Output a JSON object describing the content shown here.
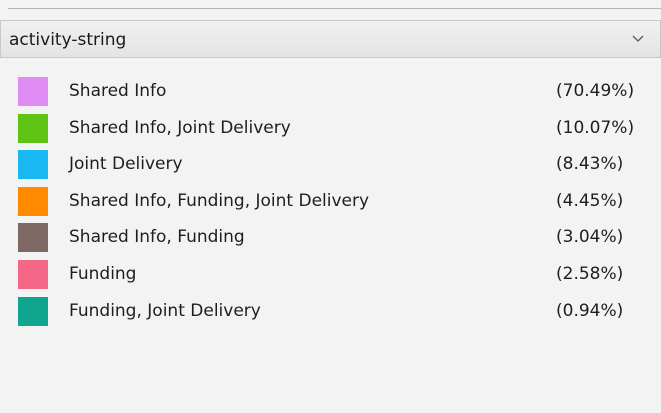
{
  "dropdown": {
    "value": "activity-string",
    "icon": "chevron-down-icon"
  },
  "legend": {
    "items": [
      {
        "label": "Shared Info",
        "percent": "(70.49%)",
        "color": "#e08cf5"
      },
      {
        "label": "Shared Info, Joint Delivery",
        "percent": "(10.07%)",
        "color": "#5fc314"
      },
      {
        "label": "Joint Delivery",
        "percent": "(8.43%)",
        "color": "#1ab8f2"
      },
      {
        "label": "Shared Info, Funding, Joint Delivery",
        "percent": "(4.45%)",
        "color": "#ff8a00"
      },
      {
        "label": "Shared Info, Funding",
        "percent": "(3.04%)",
        "color": "#7d6863"
      },
      {
        "label": "Funding",
        "percent": "(2.58%)",
        "color": "#f56787"
      },
      {
        "label": "Funding, Joint Delivery",
        "percent": "(0.94%)",
        "color": "#0fa58e"
      }
    ]
  }
}
